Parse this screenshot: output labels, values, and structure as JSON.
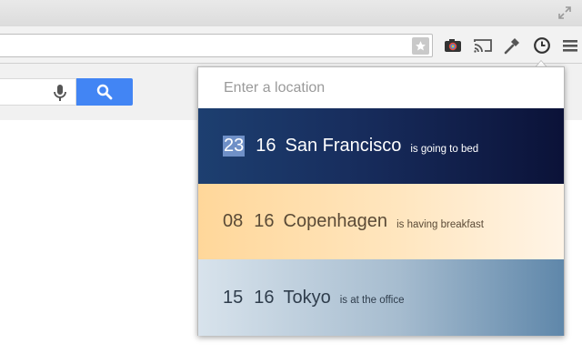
{
  "popup": {
    "input": {
      "placeholder": "Enter a location",
      "value": ""
    },
    "cities": [
      {
        "hours": "23",
        "minutes": "16",
        "city": "San Francisco",
        "status": "is going to bed"
      },
      {
        "hours": "08",
        "minutes": "16",
        "city": "Copenhagen",
        "status": "is having breakfast"
      },
      {
        "hours": "15",
        "minutes": "16",
        "city": "Tokyo",
        "status": "is at the office"
      }
    ]
  },
  "colors": {
    "search_button": "#4285f4",
    "san_francisco_row": "#172c5c",
    "copenhagen_row": "#ffe0ae",
    "tokyo_row": "#a6bccf"
  }
}
